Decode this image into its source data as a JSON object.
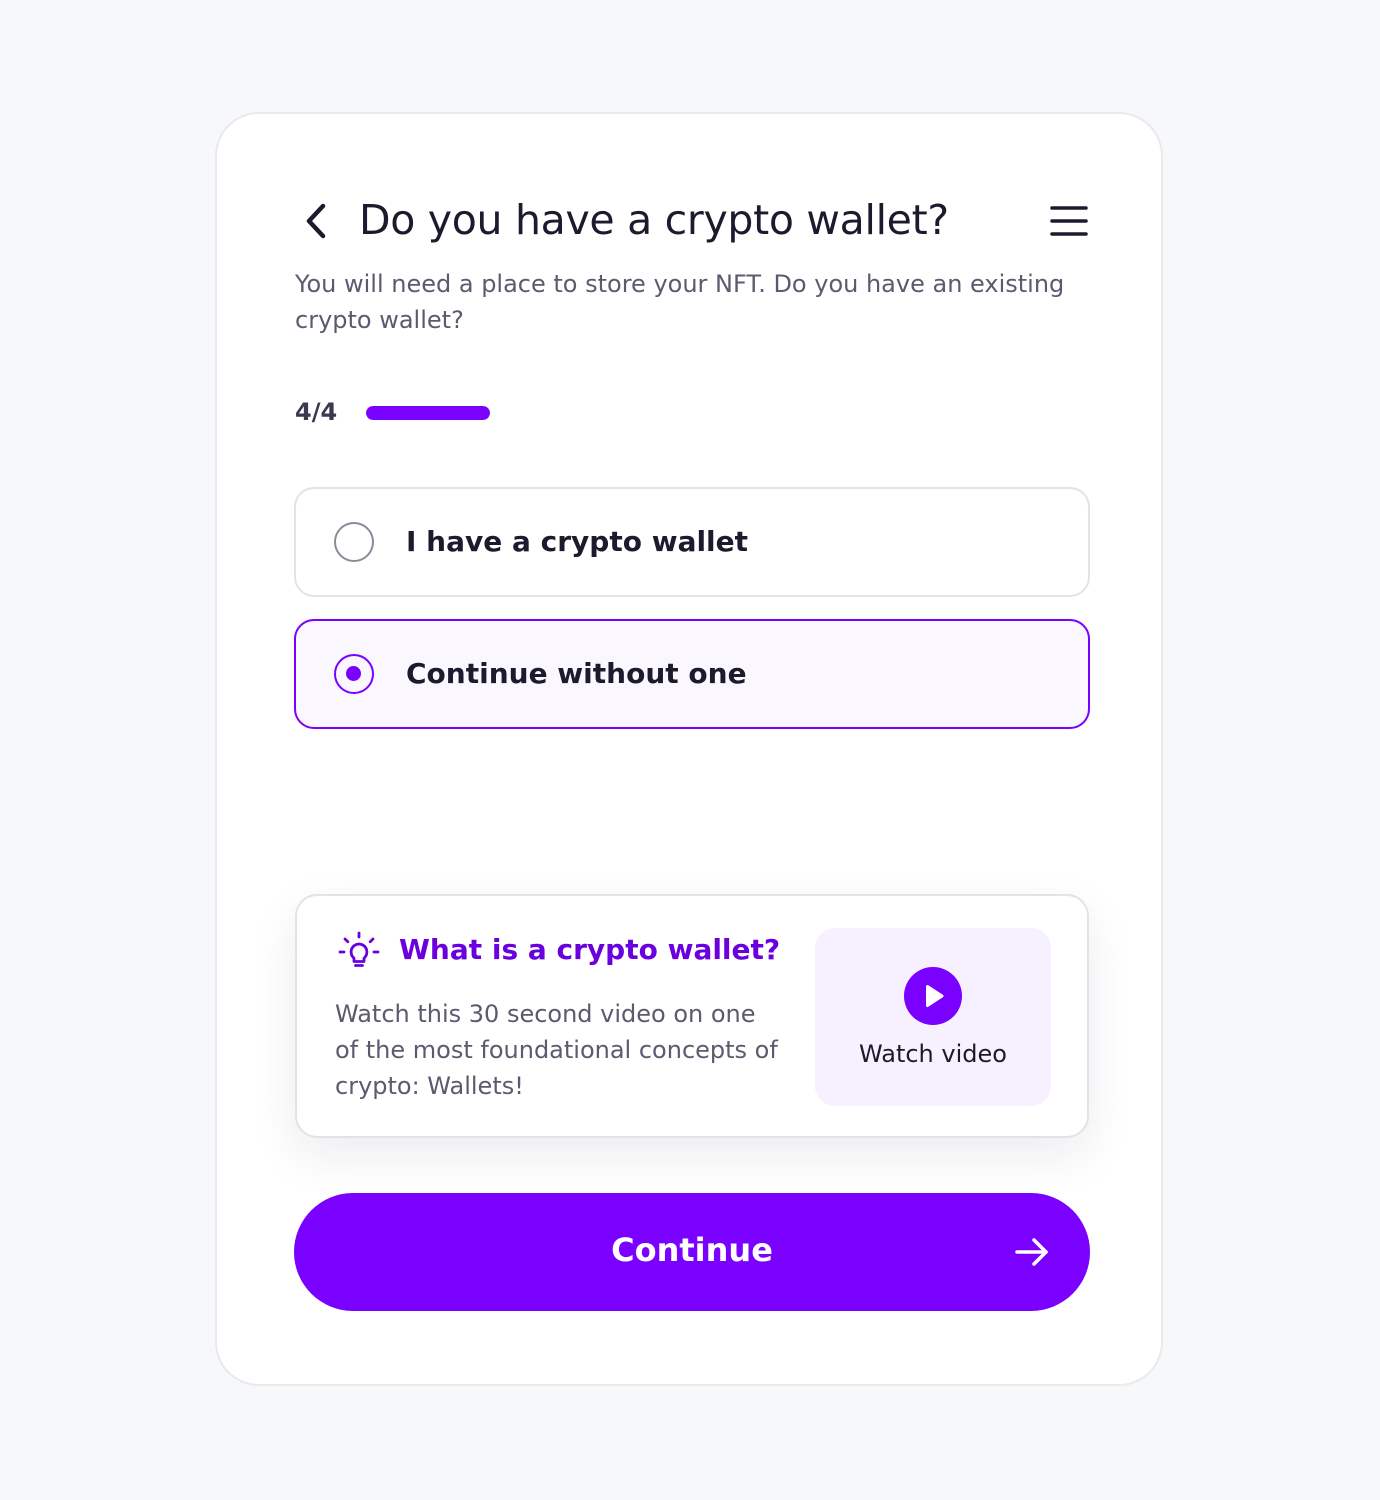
{
  "header": {
    "title": "Do you have a crypto wallet?",
    "back_icon": "chevron-left-icon",
    "menu_icon": "hamburger-menu-icon"
  },
  "subtitle": "You will need a place to store your NFT. Do you have an existing crypto wallet?",
  "progress": {
    "label": "4/4",
    "current_step": 4,
    "total_steps": 4,
    "fill_fraction": 1.0
  },
  "options": [
    {
      "label": "I have a crypto wallet",
      "selected": false
    },
    {
      "label": "Continue without one",
      "selected": true
    }
  ],
  "info": {
    "icon": "lightbulb-icon",
    "title": "What is a crypto wallet?",
    "text": "Watch this 30 second video on one of the most foundational concepts of crypto: Wallets!",
    "video": {
      "icon": "play-icon",
      "label": "Watch video"
    }
  },
  "continue_button": {
    "label": "Continue",
    "icon": "arrow-right-icon"
  },
  "colors": {
    "accent": "#7a00ff",
    "accent_dark": "#6a00dd",
    "accent_light_bg": "#f6f0ff",
    "text_primary": "#1c1b2e",
    "text_secondary": "#5c5a6e",
    "page_bg": "#f7f8fa"
  }
}
